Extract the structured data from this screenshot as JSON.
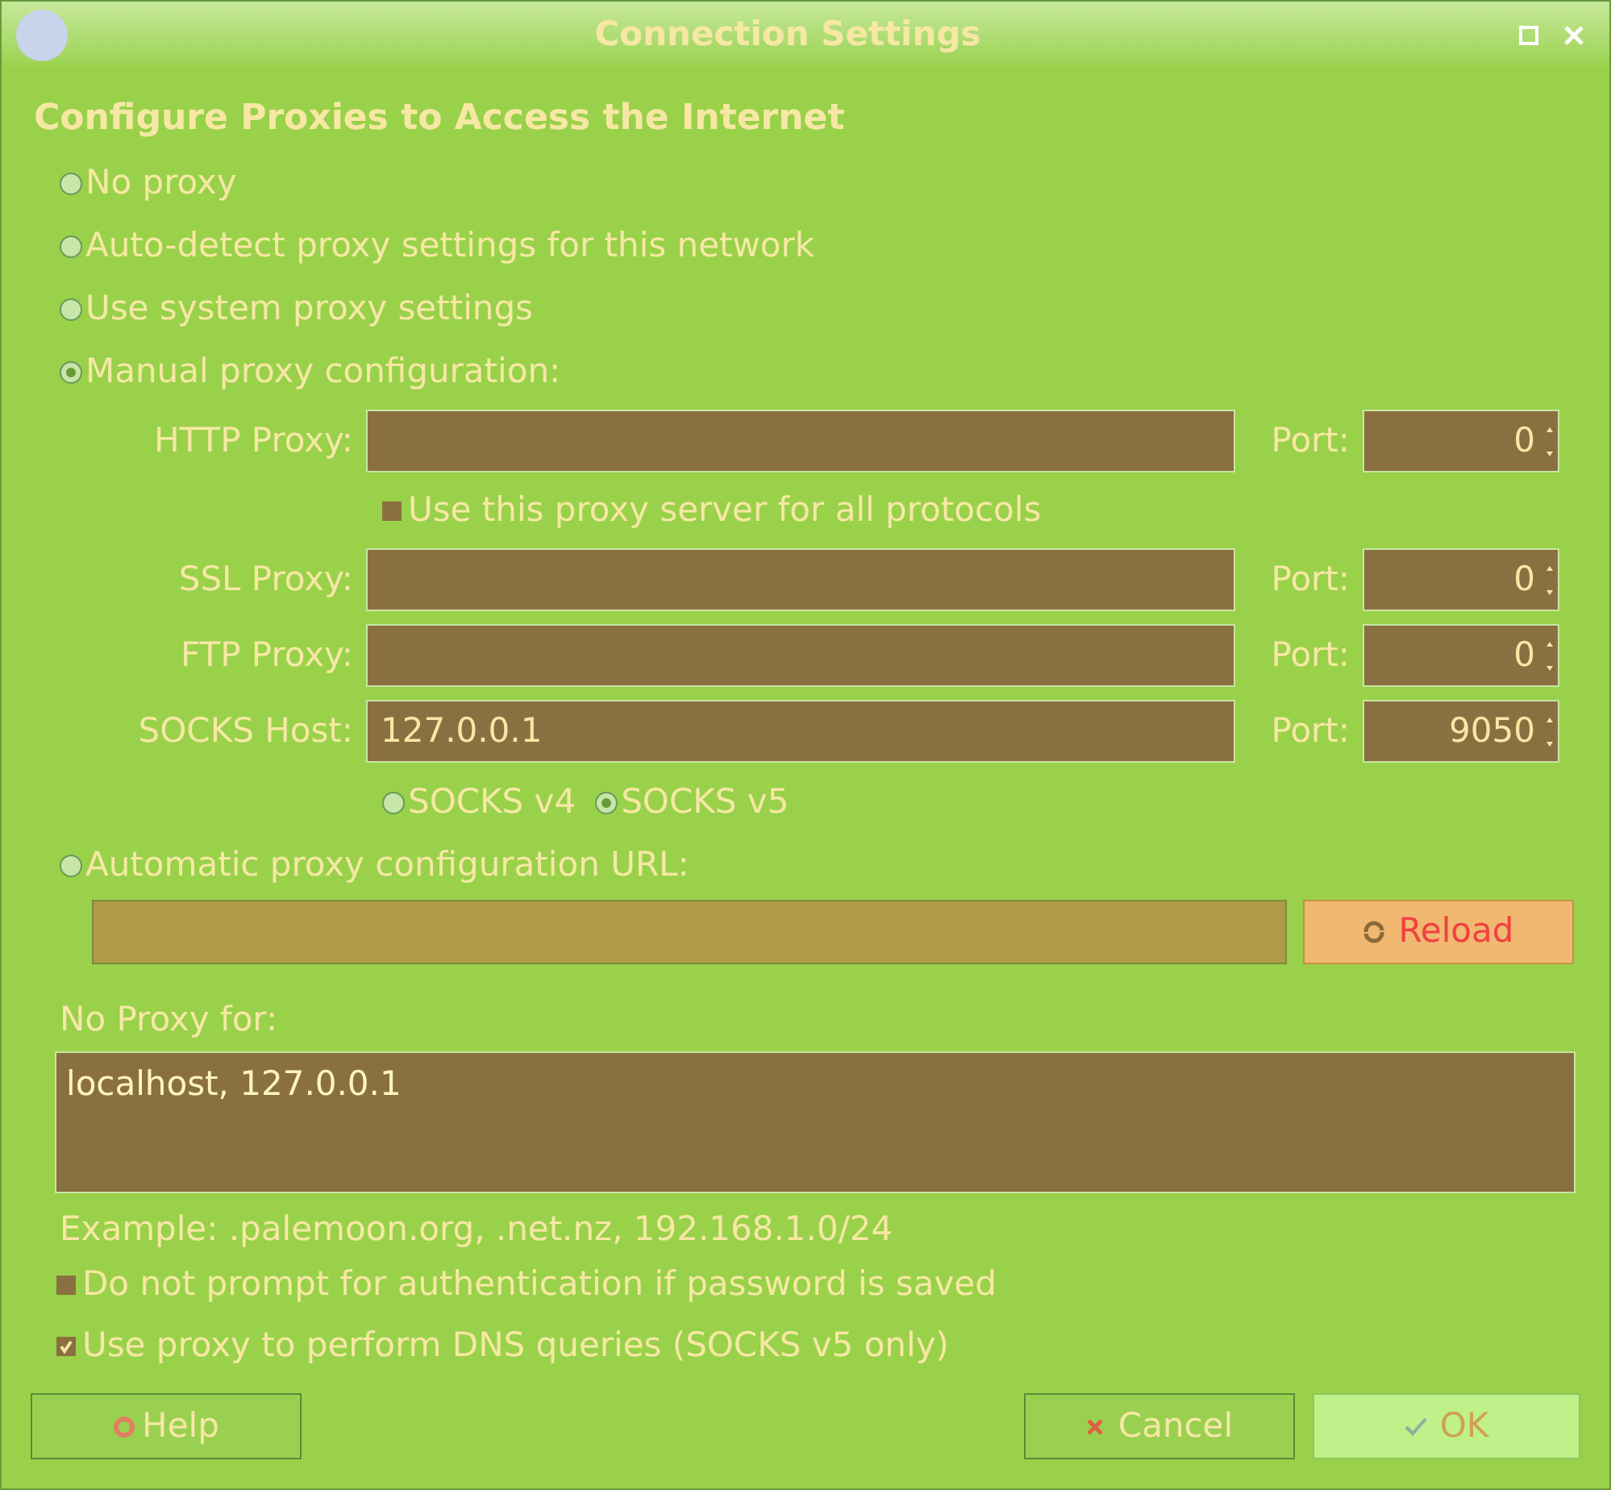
{
  "window": {
    "title": "Connection Settings"
  },
  "heading": "Configure Proxies to Access the Internet",
  "modes": [
    {
      "label": "No proxy",
      "selected": false
    },
    {
      "label": "Auto-detect proxy settings for this network",
      "selected": false
    },
    {
      "label": "Use system proxy settings",
      "selected": false
    },
    {
      "label": "Manual proxy configuration:",
      "selected": true
    }
  ],
  "http": {
    "label": "HTTP Proxy:",
    "port_label": "Port:",
    "port": "0"
  },
  "share_all": {
    "label": "Use this proxy server for all protocols",
    "checked": false
  },
  "proxies": [
    {
      "label": "SSL Proxy:",
      "port_label": "Port:",
      "port": "0"
    },
    {
      "label": "FTP Proxy:",
      "port_label": "Port:",
      "port": "0"
    },
    {
      "label": "SOCKS Host:",
      "value": "127.0.0.1",
      "port_label": "Port:",
      "port": "9050"
    }
  ],
  "socks_versions": [
    {
      "label": "SOCKS v4",
      "selected": false
    },
    {
      "label": "SOCKS v5",
      "selected": true
    }
  ],
  "auto_url": {
    "label": "Automatic proxy configuration URL:",
    "selected": false,
    "reload": "Reload"
  },
  "no_proxy": {
    "label": "No Proxy for:",
    "value": "localhost, 127.0.0.1",
    "example": "Example: .palemoon.org, .net.nz, 192.168.1.0/24"
  },
  "options": [
    {
      "label": "Do not prompt for authentication if password is saved",
      "checked": false
    },
    {
      "label": "Use proxy to perform DNS queries (SOCKS v5 only)",
      "checked": true
    }
  ],
  "buttons": {
    "help": "Help",
    "cancel": "Cancel",
    "ok": "OK"
  }
}
